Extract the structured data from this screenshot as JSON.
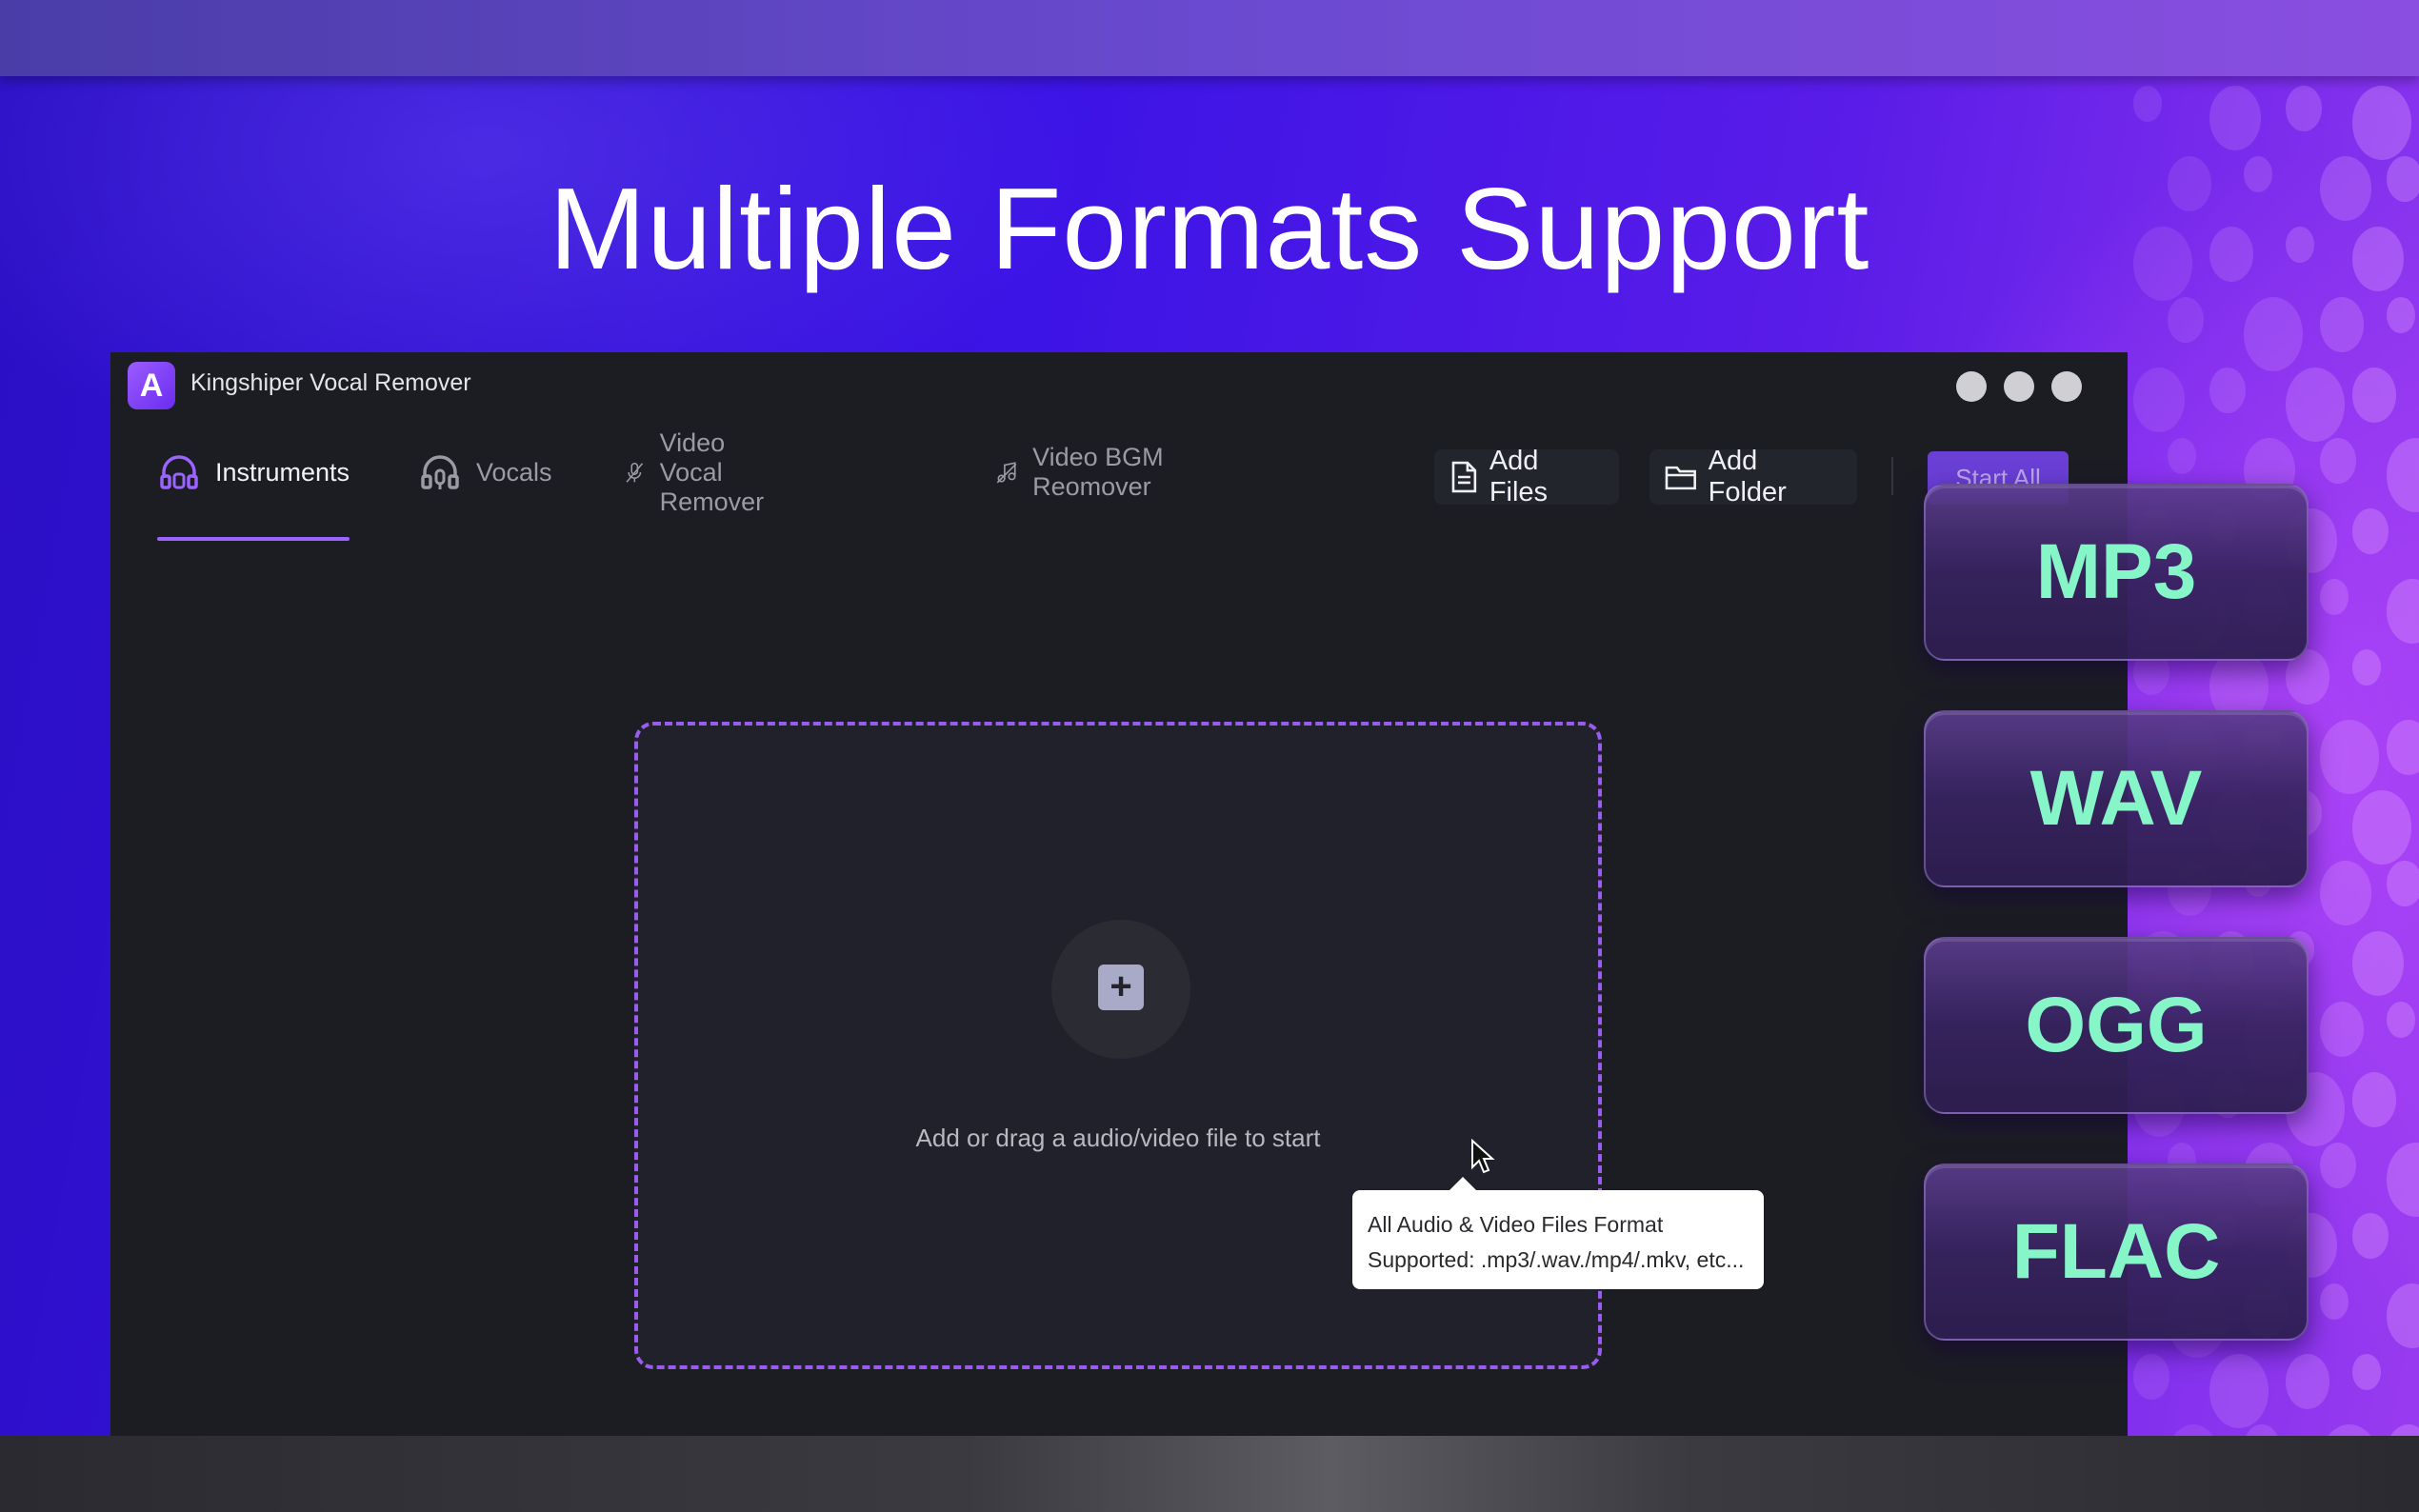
{
  "headline": "Multiple Formats Support",
  "app": {
    "title": "Kingshiper Vocal Remover",
    "logo_letter": "A"
  },
  "tabs": [
    {
      "label": "Instruments",
      "icon": "headphones-icon",
      "active": true
    },
    {
      "label": "Vocals",
      "icon": "headphones-mic-icon",
      "active": false
    },
    {
      "label": "Video Vocal Remover",
      "icon": "mic-off-icon",
      "active": false
    },
    {
      "label": "Video BGM Reomover",
      "icon": "music-off-icon",
      "active": false
    }
  ],
  "toolbar": {
    "add_files_label": "Add Files",
    "add_folder_label": "Add Folder",
    "start_all_label": "Start All"
  },
  "dropzone": {
    "plus": "+",
    "hint": "Add or drag a audio/video file to start"
  },
  "tooltip": {
    "line1": "All Audio & Video Files Format",
    "line2": "Supported: .mp3/.wav./mp4/.mkv, etc..."
  },
  "formats": [
    "MP3",
    "WAV",
    "OGG",
    "FLAC"
  ],
  "colors": {
    "accent": "#9b63ff",
    "format_text": "#86f5c8",
    "app_bg": "#1c1d23"
  }
}
